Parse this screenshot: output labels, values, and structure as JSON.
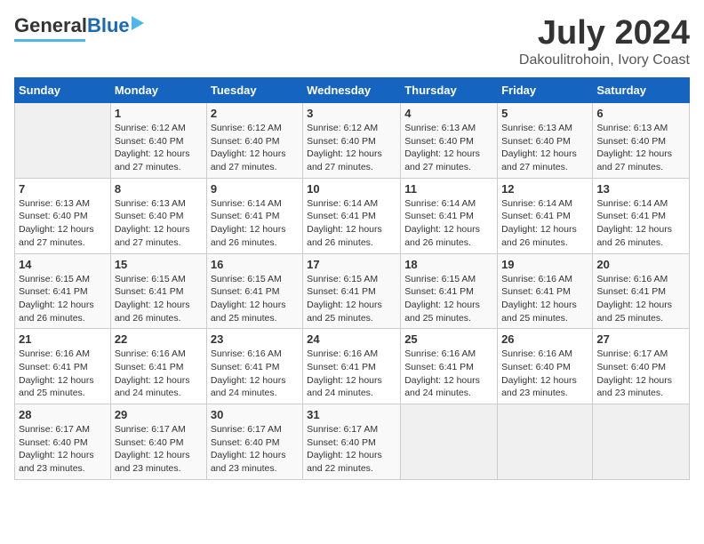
{
  "logo": {
    "general": "General",
    "blue": "Blue"
  },
  "title": "July 2024",
  "subtitle": "Dakoulitrohoin, Ivory Coast",
  "days": [
    "Sunday",
    "Monday",
    "Tuesday",
    "Wednesday",
    "Thursday",
    "Friday",
    "Saturday"
  ],
  "weeks": [
    [
      {
        "day": "",
        "content": ""
      },
      {
        "day": "1",
        "content": "Sunrise: 6:12 AM\nSunset: 6:40 PM\nDaylight: 12 hours\nand 27 minutes."
      },
      {
        "day": "2",
        "content": "Sunrise: 6:12 AM\nSunset: 6:40 PM\nDaylight: 12 hours\nand 27 minutes."
      },
      {
        "day": "3",
        "content": "Sunrise: 6:12 AM\nSunset: 6:40 PM\nDaylight: 12 hours\nand 27 minutes."
      },
      {
        "day": "4",
        "content": "Sunrise: 6:13 AM\nSunset: 6:40 PM\nDaylight: 12 hours\nand 27 minutes."
      },
      {
        "day": "5",
        "content": "Sunrise: 6:13 AM\nSunset: 6:40 PM\nDaylight: 12 hours\nand 27 minutes."
      },
      {
        "day": "6",
        "content": "Sunrise: 6:13 AM\nSunset: 6:40 PM\nDaylight: 12 hours\nand 27 minutes."
      }
    ],
    [
      {
        "day": "7",
        "content": "Sunrise: 6:13 AM\nSunset: 6:40 PM\nDaylight: 12 hours\nand 27 minutes."
      },
      {
        "day": "8",
        "content": "Sunrise: 6:13 AM\nSunset: 6:40 PM\nDaylight: 12 hours\nand 27 minutes."
      },
      {
        "day": "9",
        "content": "Sunrise: 6:14 AM\nSunset: 6:41 PM\nDaylight: 12 hours\nand 26 minutes."
      },
      {
        "day": "10",
        "content": "Sunrise: 6:14 AM\nSunset: 6:41 PM\nDaylight: 12 hours\nand 26 minutes."
      },
      {
        "day": "11",
        "content": "Sunrise: 6:14 AM\nSunset: 6:41 PM\nDaylight: 12 hours\nand 26 minutes."
      },
      {
        "day": "12",
        "content": "Sunrise: 6:14 AM\nSunset: 6:41 PM\nDaylight: 12 hours\nand 26 minutes."
      },
      {
        "day": "13",
        "content": "Sunrise: 6:14 AM\nSunset: 6:41 PM\nDaylight: 12 hours\nand 26 minutes."
      }
    ],
    [
      {
        "day": "14",
        "content": "Sunrise: 6:15 AM\nSunset: 6:41 PM\nDaylight: 12 hours\nand 26 minutes."
      },
      {
        "day": "15",
        "content": "Sunrise: 6:15 AM\nSunset: 6:41 PM\nDaylight: 12 hours\nand 26 minutes."
      },
      {
        "day": "16",
        "content": "Sunrise: 6:15 AM\nSunset: 6:41 PM\nDaylight: 12 hours\nand 25 minutes."
      },
      {
        "day": "17",
        "content": "Sunrise: 6:15 AM\nSunset: 6:41 PM\nDaylight: 12 hours\nand 25 minutes."
      },
      {
        "day": "18",
        "content": "Sunrise: 6:15 AM\nSunset: 6:41 PM\nDaylight: 12 hours\nand 25 minutes."
      },
      {
        "day": "19",
        "content": "Sunrise: 6:16 AM\nSunset: 6:41 PM\nDaylight: 12 hours\nand 25 minutes."
      },
      {
        "day": "20",
        "content": "Sunrise: 6:16 AM\nSunset: 6:41 PM\nDaylight: 12 hours\nand 25 minutes."
      }
    ],
    [
      {
        "day": "21",
        "content": "Sunrise: 6:16 AM\nSunset: 6:41 PM\nDaylight: 12 hours\nand 25 minutes."
      },
      {
        "day": "22",
        "content": "Sunrise: 6:16 AM\nSunset: 6:41 PM\nDaylight: 12 hours\nand 24 minutes."
      },
      {
        "day": "23",
        "content": "Sunrise: 6:16 AM\nSunset: 6:41 PM\nDaylight: 12 hours\nand 24 minutes."
      },
      {
        "day": "24",
        "content": "Sunrise: 6:16 AM\nSunset: 6:41 PM\nDaylight: 12 hours\nand 24 minutes."
      },
      {
        "day": "25",
        "content": "Sunrise: 6:16 AM\nSunset: 6:41 PM\nDaylight: 12 hours\nand 24 minutes."
      },
      {
        "day": "26",
        "content": "Sunrise: 6:16 AM\nSunset: 6:40 PM\nDaylight: 12 hours\nand 23 minutes."
      },
      {
        "day": "27",
        "content": "Sunrise: 6:17 AM\nSunset: 6:40 PM\nDaylight: 12 hours\nand 23 minutes."
      }
    ],
    [
      {
        "day": "28",
        "content": "Sunrise: 6:17 AM\nSunset: 6:40 PM\nDaylight: 12 hours\nand 23 minutes."
      },
      {
        "day": "29",
        "content": "Sunrise: 6:17 AM\nSunset: 6:40 PM\nDaylight: 12 hours\nand 23 minutes."
      },
      {
        "day": "30",
        "content": "Sunrise: 6:17 AM\nSunset: 6:40 PM\nDaylight: 12 hours\nand 23 minutes."
      },
      {
        "day": "31",
        "content": "Sunrise: 6:17 AM\nSunset: 6:40 PM\nDaylight: 12 hours\nand 22 minutes."
      },
      {
        "day": "",
        "content": ""
      },
      {
        "day": "",
        "content": ""
      },
      {
        "day": "",
        "content": ""
      }
    ]
  ]
}
